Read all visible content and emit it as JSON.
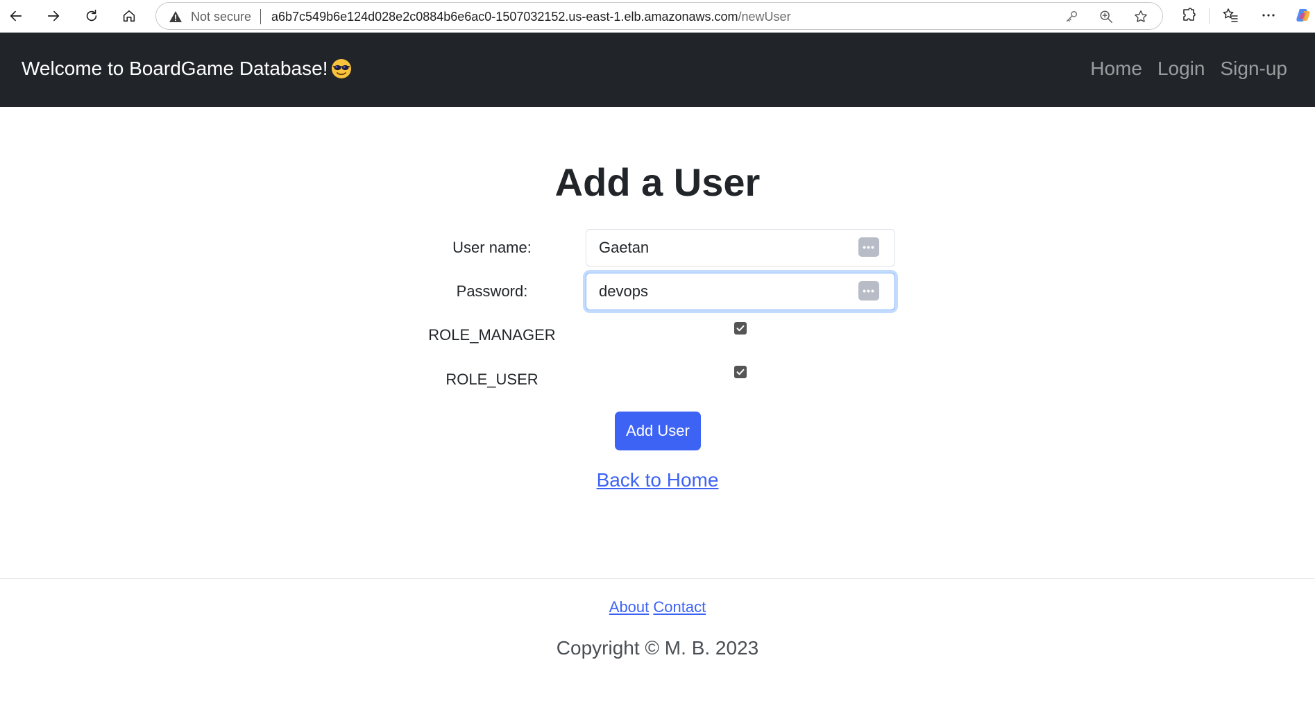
{
  "browser": {
    "security_label": "Not secure",
    "url_host": "a6b7c549b6e124d028e2c0884b6e6ac0-1507032152.us-east-1.elb.amazonaws.com",
    "url_path": "/newUser",
    "icons": [
      "back-arrow-icon",
      "forward-arrow-icon",
      "reload-icon",
      "home-icon",
      "warning-icon",
      "key-icon",
      "zoom-icon",
      "star-icon",
      "extensions-icon",
      "favorites-icon",
      "more-icon",
      "copilot-icon"
    ]
  },
  "navbar": {
    "brand": "Welcome to BoardGame Database!",
    "brand_emoji": "sunglasses-emoji",
    "links": {
      "home": "Home",
      "login": "Login",
      "signup": "Sign-up"
    }
  },
  "form": {
    "title": "Add a User",
    "username": {
      "label": "User name:",
      "value": "Gaetan"
    },
    "password": {
      "label": "Password:",
      "value": "devops"
    },
    "roles": [
      {
        "label": "ROLE_MANAGER",
        "checked": true
      },
      {
        "label": "ROLE_USER",
        "checked": true
      }
    ],
    "submit_label": "Add User",
    "back_label": "Back to Home"
  },
  "footer": {
    "about": "About",
    "contact": "Contact",
    "copyright": "Copyright © M. B. 2023"
  },
  "colors": {
    "navbar_bg": "#212529",
    "primary": "#3d63f5",
    "focus_ring": "#86b7fe"
  }
}
